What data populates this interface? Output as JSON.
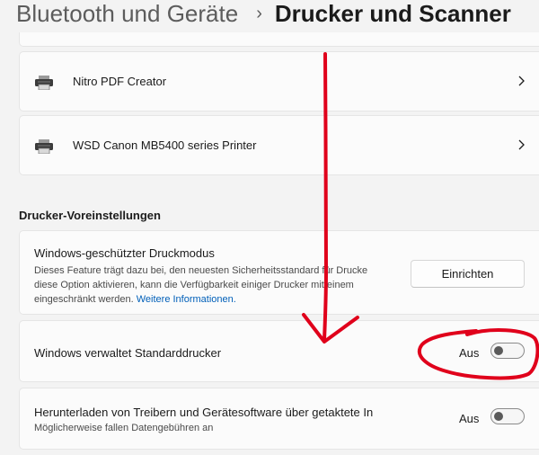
{
  "breadcrumb": {
    "parent": "Bluetooth und Geräte",
    "separator": "›",
    "current": "Drucker und Scanner"
  },
  "printers": [
    {
      "name": "Nitro PDF Creator",
      "icon": "printer-icon"
    },
    {
      "name": "WSD Canon MB5400 series Printer",
      "icon": "printer-icon"
    }
  ],
  "preferences": {
    "section_title": "Drucker-Voreinstellungen",
    "protected_mode": {
      "title": "Windows-geschützter Druckmodus",
      "desc_line1": "Dieses Feature trägt dazu bei, den neuesten Sicherheitsstandard für Drucke",
      "desc_line2": "diese Option aktivieren, kann die Verfügbarkeit einiger Drucker mit einem",
      "desc_line3": "eingeschränkt werden.",
      "link": "Weitere Informationen.",
      "button": "Einrichten"
    },
    "default_printer": {
      "title": "Windows verwaltet Standarddrucker",
      "state_label": "Aus",
      "state": "off"
    },
    "metered_download": {
      "title": "Herunterladen von Treibern und Gerätesoftware über getaktete In",
      "subtitle": "Möglicherweise fallen Datengebühren an",
      "state_label": "Aus",
      "state": "off"
    }
  },
  "colors": {
    "background": "#f3f3f3",
    "card": "#fbfbfb",
    "link": "#005fb8",
    "annotation": "#e0001b"
  }
}
